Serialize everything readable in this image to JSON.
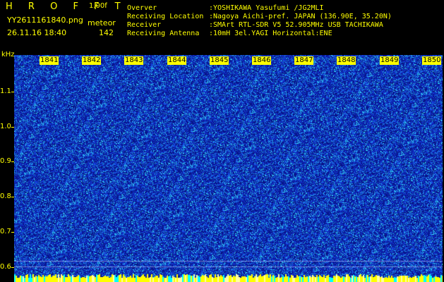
{
  "header": {
    "app_title": "H R O F F T",
    "version": "1.00f",
    "filename": "YY2611161840.png",
    "mode": "meteor",
    "datetime": "26.11.16 18:40",
    "count": "142"
  },
  "info": [
    {
      "label": "Overver",
      "value": ":YOSHIKAWA Yasufumi /JG2MLI"
    },
    {
      "label": "Receiving Location",
      "value": ":Nagoya Aichi-pref. JAPAN (136.90E, 35.20N)"
    },
    {
      "label": "Receiver",
      "value": ":SMArt RTL-SDR V5 52.905MHz USB TACHIKAWA"
    },
    {
      "label": "Receiving Antenna",
      "value": ":10mH 3el.YAGI Horizontal:ENE"
    }
  ],
  "axis": {
    "unit": "kHz",
    "y_labels": [
      "1.1",
      "1.0",
      "0.9",
      "0.8",
      "0.7",
      "0.6"
    ],
    "time_labels": [
      "1841",
      "1842",
      "1843",
      "1844",
      "1845",
      "1846",
      "1847",
      "1848",
      "1849",
      "1850"
    ]
  },
  "colors": {
    "background": "#000000",
    "text": "#ffff00",
    "spectrogram_base": "#0a1a8c",
    "noise_high": "#00e0ff",
    "bottom_strip": "#ffff00"
  }
}
